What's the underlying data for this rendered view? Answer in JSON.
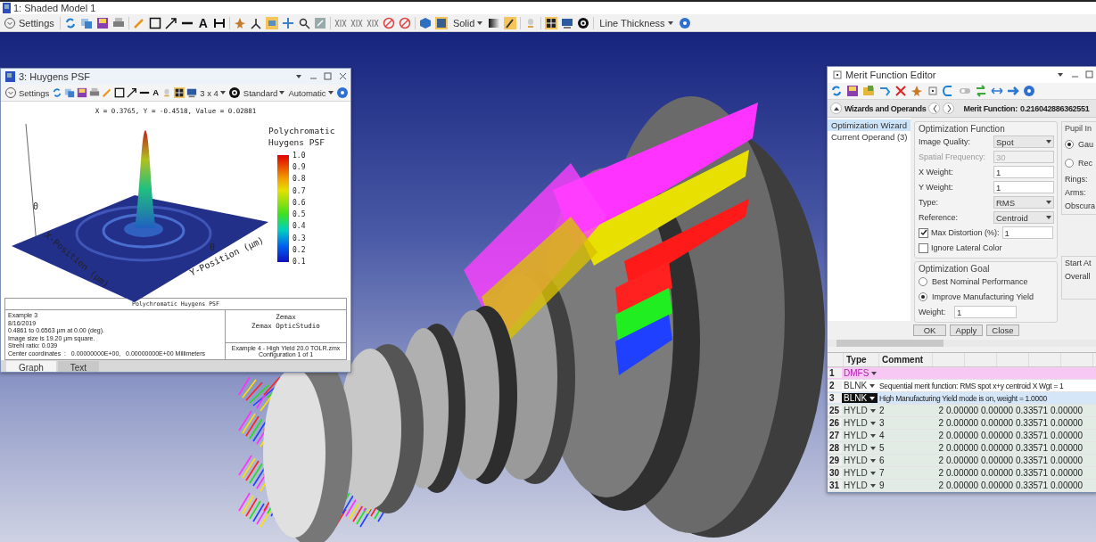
{
  "main_window": {
    "title": "1: Shaded Model 1",
    "toolbar": {
      "settings": "Settings",
      "text_tool": "A",
      "shading": "Solid",
      "line_thickness": "Line Thickness"
    }
  },
  "psf_window": {
    "title": "3: Huygens PSF",
    "toolbar": {
      "settings": "Settings",
      "text_tool": "A",
      "layout": "3 x 4",
      "style": "Standard",
      "scale": "Automatic"
    },
    "cursor_readout": "X = 0.3765, Y = -0.4518, Value = 0.02881",
    "plot": {
      "legend_title": "Polychromatic Huygens PSF",
      "legend_ticks": [
        "1.0",
        "0.9",
        "0.8",
        "0.7",
        "0.6",
        "0.5",
        "0.4",
        "0.3",
        "0.2",
        "0.1"
      ],
      "z_origin": "0",
      "y_origin": "0",
      "x_axis": "X-Position (µm)",
      "y_axis": "Y-Position (µm)"
    },
    "footer": {
      "heading": "Polychromatic Huygens PSF",
      "details": [
        "Example 3",
        "8/16/2019",
        "0.4861 to 0.6563 µm at 0.00 (deg).",
        "Image size is 19.20 µm square.",
        "Strehl ratio: 0.039",
        "Center coordinates  :   0.00000000E+00,   0.00000000E+00 Millimeters"
      ],
      "company": "Zemax",
      "product": "Zemax OpticStudio",
      "file": "Example 4 - High Yield 20.0 TOLR.zmx",
      "configuration": "Configuration 1 of 1"
    },
    "tabs": [
      {
        "label": "Graph",
        "selected": true
      },
      {
        "label": "Text",
        "selected": false
      }
    ]
  },
  "merit_editor": {
    "title": "Merit Function Editor",
    "bar_title": "Wizards and Operands",
    "merit_label": "Merit Function:",
    "merit_value": "0.216042886362551",
    "nav_items": [
      {
        "label": "Optimization Wizard",
        "selected": true
      },
      {
        "label": "Current Operand (3)",
        "selected": false
      }
    ],
    "function_group": {
      "title": "Optimization Function",
      "rows": [
        {
          "kind": "dropdown",
          "label": "Image Quality:",
          "value": "Spot",
          "disabled": false
        },
        {
          "kind": "text",
          "label": "Spatial Frequency:",
          "value": "30",
          "disabled": true
        },
        {
          "kind": "text",
          "label": "X Weight:",
          "value": "1",
          "disabled": false
        },
        {
          "kind": "text",
          "label": "Y Weight:",
          "value": "1",
          "disabled": false
        },
        {
          "kind": "dropdown",
          "label": "Type:",
          "value": "RMS",
          "disabled": false
        },
        {
          "kind": "dropdown",
          "label": "Reference:",
          "value": "Centroid",
          "disabled": false
        },
        {
          "kind": "checkbox",
          "label": "Max Distortion (%):",
          "value": "1",
          "checked": true
        },
        {
          "kind": "checkbox",
          "label": "Ignore Lateral Color",
          "checked": false
        }
      ]
    },
    "goal_group": {
      "title": "Optimization Goal",
      "options": [
        {
          "label": "Best Nominal Performance",
          "selected": false
        },
        {
          "label": "Improve Manufacturing Yield",
          "selected": true
        }
      ],
      "weight_label": "Weight:",
      "weight_value": "1"
    },
    "pupil_group": {
      "title": "Pupil In",
      "options": [
        {
          "label": "Gau",
          "selected": true
        },
        {
          "label": "Rec",
          "selected": false
        }
      ],
      "labels": [
        "Rings:",
        "Arms:",
        "Obscura"
      ]
    },
    "start_group": {
      "labels": [
        "Start At",
        "Overall"
      ]
    },
    "buttons": [
      "OK",
      "Apply",
      "Close"
    ],
    "table": {
      "columns": [
        "Type",
        "Comment"
      ],
      "rows": [
        {
          "kind": "header",
          "number": "1",
          "type": "DMFS",
          "selected": false
        },
        {
          "kind": "blank",
          "number": "2",
          "type": "BLNK",
          "comment": "Sequential merit function: RMS spot x+y centroid X Wgt = 1",
          "selected": false
        },
        {
          "kind": "blank",
          "number": "3",
          "type": "BLNK",
          "comment": "High Manufacturing Yield mode is on, weight = 1.0000",
          "selected": true
        },
        {
          "kind": "operand",
          "number": "25",
          "type": "HYLD",
          "comment": "2",
          "values": [
            "2",
            "0.00000",
            "0.00000",
            "0.33571",
            "0.00000"
          ],
          "selected": false
        },
        {
          "kind": "operand",
          "number": "26",
          "type": "HYLD",
          "comment": "3",
          "values": [
            "2",
            "0.00000",
            "0.00000",
            "0.33571",
            "0.00000"
          ],
          "selected": false
        },
        {
          "kind": "operand",
          "number": "27",
          "type": "HYLD",
          "comment": "4",
          "values": [
            "2",
            "0.00000",
            "0.00000",
            "0.33571",
            "0.00000"
          ],
          "selected": false
        },
        {
          "kind": "operand",
          "number": "28",
          "type": "HYLD",
          "comment": "5",
          "values": [
            "2",
            "0.00000",
            "0.00000",
            "0.33571",
            "0.00000"
          ],
          "selected": false
        },
        {
          "kind": "operand",
          "number": "29",
          "type": "HYLD",
          "comment": "6",
          "values": [
            "2",
            "0.00000",
            "0.00000",
            "0.33571",
            "0.00000"
          ],
          "selected": false
        },
        {
          "kind": "operand",
          "number": "30",
          "type": "HYLD",
          "comment": "7",
          "values": [
            "2",
            "0.00000",
            "0.00000",
            "0.33571",
            "0.00000"
          ],
          "selected": false
        },
        {
          "kind": "operand",
          "number": "31",
          "type": "HYLD",
          "comment": "9",
          "values": [
            "2",
            "0.00000",
            "0.00000",
            "0.33571",
            "0.00000"
          ],
          "selected": false
        }
      ]
    }
  }
}
